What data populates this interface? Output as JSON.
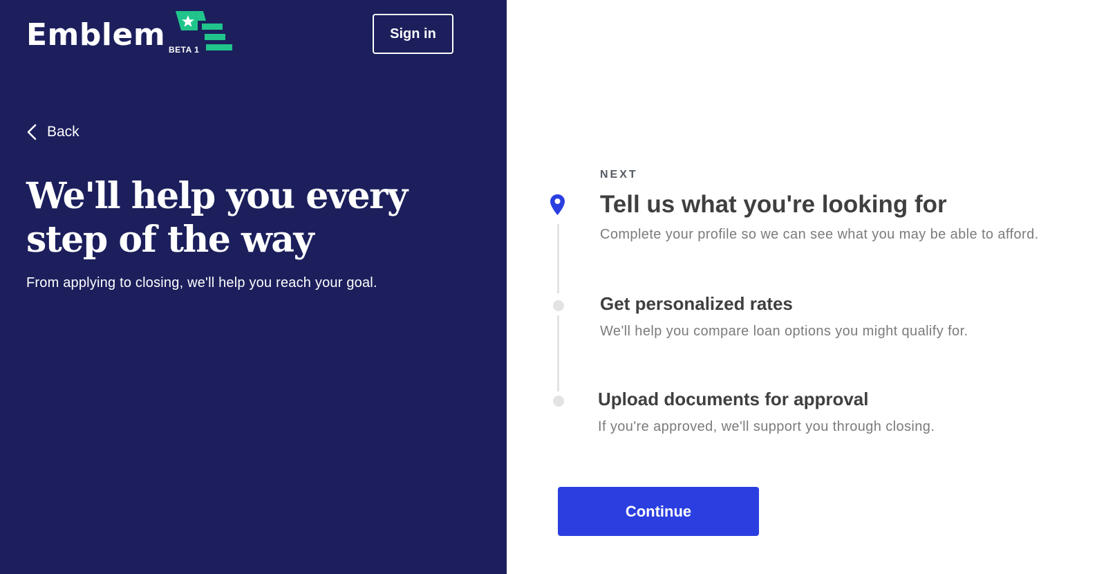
{
  "brand": {
    "name": "Emblem",
    "badge": "BETA 1",
    "accent_color": "#21c48b"
  },
  "header": {
    "signin_label": "Sign in"
  },
  "nav": {
    "back_label": "Back",
    "back_icon": "chevron-left-icon"
  },
  "hero": {
    "title": "We'll help you every step of the way",
    "subtitle": "From applying to closing, we'll help you reach your goal."
  },
  "steps": {
    "eyebrow": "NEXT",
    "items": [
      {
        "title": "Tell us what you're looking for",
        "description": "Complete your profile so we can see what you may be able to afford.",
        "icon": "location-pin-icon",
        "state": "current"
      },
      {
        "title": "Get personalized rates",
        "description": "We'll help you compare loan options you might qualify for.",
        "icon": "dot-icon",
        "state": "upcoming"
      },
      {
        "title": "Upload documents for approval",
        "description": "If you're approved, we'll support you through closing.",
        "icon": "dot-icon",
        "state": "upcoming"
      }
    ]
  },
  "actions": {
    "continue_label": "Continue"
  },
  "colors": {
    "left_panel_bg": "#1c1f5c",
    "primary_button": "#2b3fe0",
    "pin": "#2b3fe0"
  }
}
